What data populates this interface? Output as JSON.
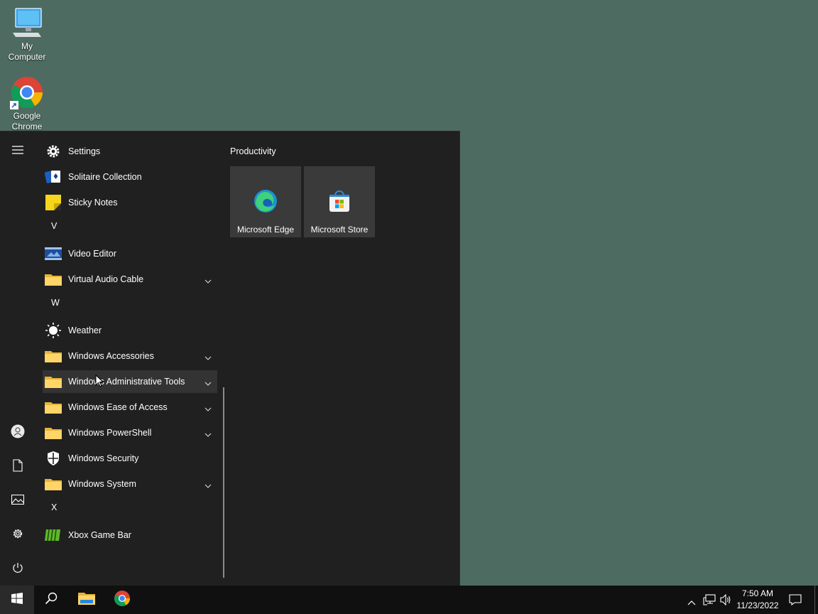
{
  "desktop": {
    "icons": [
      {
        "label": "My Computer",
        "icon": "computer-icon"
      },
      {
        "label": "Google Chrome",
        "icon": "chrome-icon"
      }
    ]
  },
  "start_menu": {
    "rail": [
      {
        "name": "expand-menu",
        "icon": "hamburger-icon"
      },
      {
        "name": "account",
        "icon": "user-icon"
      },
      {
        "name": "documents",
        "icon": "document-icon"
      },
      {
        "name": "pictures",
        "icon": "pictures-icon"
      },
      {
        "name": "settings",
        "icon": "gear-icon"
      },
      {
        "name": "power",
        "icon": "power-icon"
      }
    ],
    "apps": [
      {
        "label": "Settings",
        "icon": "gear-icon"
      },
      {
        "label": "Solitaire Collection",
        "icon": "cards-icon"
      },
      {
        "label": "Sticky Notes",
        "icon": "sticky-note-icon"
      },
      {
        "letter": "V"
      },
      {
        "label": "Video Editor",
        "icon": "video-icon"
      },
      {
        "label": "Virtual Audio Cable",
        "icon": "folder-icon",
        "expandable": true
      },
      {
        "letter": "W"
      },
      {
        "label": "Weather",
        "icon": "sun-icon"
      },
      {
        "label": "Windows Accessories",
        "icon": "folder-icon",
        "expandable": true
      },
      {
        "label": "Windows Administrative Tools",
        "icon": "folder-icon",
        "expandable": true,
        "hovered": true
      },
      {
        "label": "Windows Ease of Access",
        "icon": "folder-icon",
        "expandable": true
      },
      {
        "label": "Windows PowerShell",
        "icon": "folder-icon",
        "expandable": true
      },
      {
        "label": "Windows Security",
        "icon": "shield-icon"
      },
      {
        "label": "Windows System",
        "icon": "folder-icon",
        "expandable": true
      },
      {
        "letter": "X"
      },
      {
        "label": "Xbox Game Bar",
        "icon": "xbox-game-bar-icon"
      }
    ],
    "tiles_group": "Productivity",
    "tiles": [
      {
        "label": "Microsoft Edge",
        "icon": "edge-icon"
      },
      {
        "label": "Microsoft Store",
        "icon": "store-icon"
      }
    ]
  },
  "taskbar": {
    "pinned": [
      {
        "name": "start",
        "icon": "windows-logo-icon"
      },
      {
        "name": "search",
        "icon": "search-icon"
      },
      {
        "name": "file-explorer",
        "icon": "folder-icon"
      },
      {
        "name": "chrome",
        "icon": "chrome-icon"
      }
    ],
    "tray": {
      "time": "7:50 AM",
      "date": "11/23/2022"
    }
  },
  "colors": {
    "desktop_bg": "#4e6b62",
    "menu_bg": "#202020",
    "taskbar_bg": "#101010",
    "tile_bg": "#3a3a3a"
  }
}
